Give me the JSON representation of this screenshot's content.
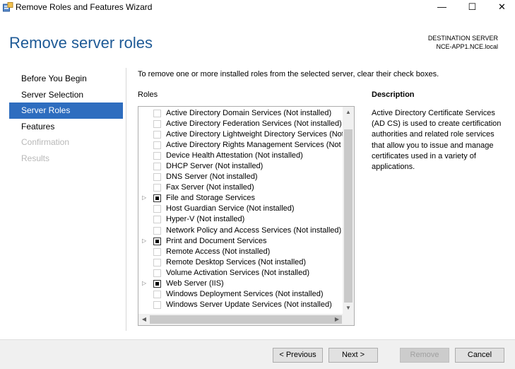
{
  "window": {
    "title": "Remove Roles and Features Wizard",
    "minimize_glyph": "—",
    "maximize_glyph": "☐",
    "close_glyph": "✕",
    "app_icon": "server-manager-icon"
  },
  "header": {
    "page_title": "Remove server roles",
    "destination_label": "DESTINATION SERVER",
    "destination_server": "NCE-APP1.NCE.local"
  },
  "nav": {
    "items": [
      {
        "label": "Before You Begin",
        "state": "normal"
      },
      {
        "label": "Server Selection",
        "state": "normal"
      },
      {
        "label": "Server Roles",
        "state": "selected"
      },
      {
        "label": "Features",
        "state": "normal"
      },
      {
        "label": "Confirmation",
        "state": "disabled"
      },
      {
        "label": "Results",
        "state": "disabled"
      }
    ]
  },
  "main": {
    "instruction": "To remove one or more installed roles from the selected server, clear their check boxes.",
    "roles_label": "Roles",
    "description_label": "Description",
    "description_text": "Active Directory Certificate Services (AD CS) is used to create certification authorities and related role services that allow you to issue and manage certificates used in a variety of applications.",
    "roles": [
      {
        "label": "Active Directory Domain Services (Not installed)",
        "checked": false,
        "expandable": false
      },
      {
        "label": "Active Directory Federation Services (Not installed)",
        "checked": false,
        "expandable": false
      },
      {
        "label": "Active Directory Lightweight Directory Services (Not installed)",
        "checked": false,
        "expandable": false
      },
      {
        "label": "Active Directory Rights Management Services (Not installed)",
        "checked": false,
        "expandable": false
      },
      {
        "label": "Device Health Attestation (Not installed)",
        "checked": false,
        "expandable": false
      },
      {
        "label": "DHCP Server (Not installed)",
        "checked": false,
        "expandable": false
      },
      {
        "label": "DNS Server (Not installed)",
        "checked": false,
        "expandable": false
      },
      {
        "label": "Fax Server (Not installed)",
        "checked": false,
        "expandable": false
      },
      {
        "label": "File and Storage Services",
        "checked": true,
        "expandable": true
      },
      {
        "label": "Host Guardian Service (Not installed)",
        "checked": false,
        "expandable": false
      },
      {
        "label": "Hyper-V (Not installed)",
        "checked": false,
        "expandable": false
      },
      {
        "label": "Network Policy and Access Services (Not installed)",
        "checked": false,
        "expandable": false
      },
      {
        "label": "Print and Document Services",
        "checked": true,
        "expandable": true
      },
      {
        "label": "Remote Access (Not installed)",
        "checked": false,
        "expandable": false
      },
      {
        "label": "Remote Desktop Services (Not installed)",
        "checked": false,
        "expandable": false
      },
      {
        "label": "Volume Activation Services (Not installed)",
        "checked": false,
        "expandable": false
      },
      {
        "label": "Web Server (IIS)",
        "checked": true,
        "expandable": true
      },
      {
        "label": "Windows Deployment Services (Not installed)",
        "checked": false,
        "expandable": false
      },
      {
        "label": "Windows Server Update Services (Not installed)",
        "checked": false,
        "expandable": false
      }
    ],
    "scroll_glyphs": {
      "up": "▲",
      "down": "▼",
      "left": "◀",
      "right": "▶"
    },
    "expand_glyph": "▷"
  },
  "footer": {
    "previous": "< Previous",
    "next": "Next >",
    "remove": "Remove",
    "cancel": "Cancel"
  },
  "colors": {
    "title_blue": "#1e5a96",
    "nav_selected": "#2e6dbf"
  }
}
